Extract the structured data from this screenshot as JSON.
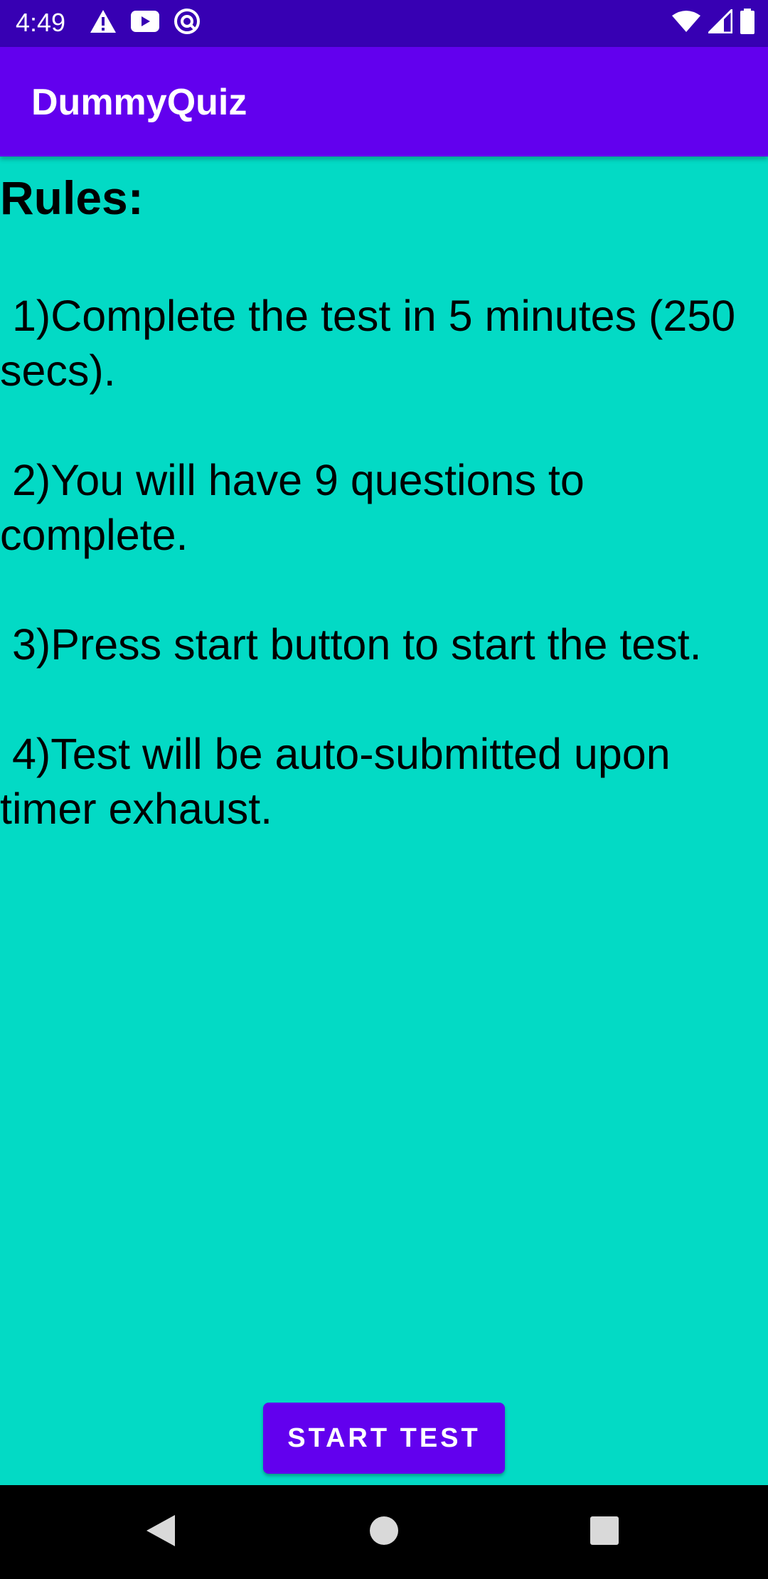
{
  "status_bar": {
    "time": "4:49",
    "icons_left": [
      "warning-icon",
      "youtube-icon",
      "vpn-icon"
    ],
    "icons_right": [
      "wifi-icon",
      "signal-icon",
      "battery-icon"
    ]
  },
  "app_bar": {
    "title": "DummyQuiz"
  },
  "rules": {
    "heading": "Rules:",
    "items": [
      " 1)Complete the test in 5 minutes (250 secs).",
      " 2)You will have 9 questions to complete.",
      " 3)Press start button to start the test.",
      " 4)Test will be auto-submitted upon timer exhaust."
    ]
  },
  "start_button": {
    "label": "START TEST"
  },
  "colors": {
    "status_bar": "#3700B3",
    "app_bar": "#6200EE",
    "background": "#03DAC5",
    "button": "#6200EE"
  },
  "nav_bar": {
    "buttons": [
      "back-icon",
      "home-icon",
      "recents-icon"
    ]
  }
}
